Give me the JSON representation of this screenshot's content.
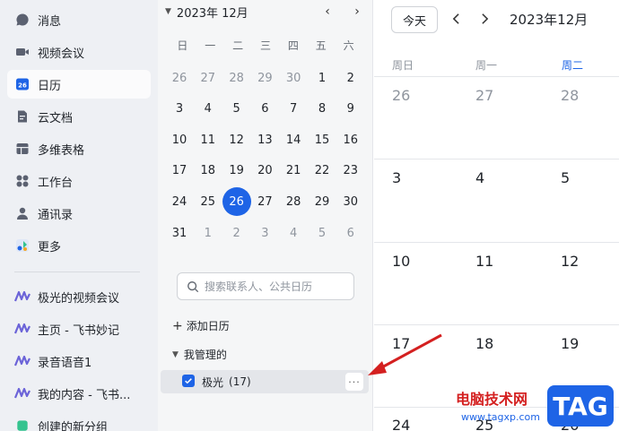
{
  "nav": {
    "items": [
      {
        "label": "消息",
        "icon": "message-icon"
      },
      {
        "label": "视频会议",
        "icon": "video-icon"
      },
      {
        "label": "日历",
        "icon": "calendar-icon",
        "badge": "26"
      },
      {
        "label": "云文档",
        "icon": "doc-icon"
      },
      {
        "label": "多维表格",
        "icon": "table-icon"
      },
      {
        "label": "工作台",
        "icon": "grid-icon"
      },
      {
        "label": "通讯录",
        "icon": "contacts-icon"
      },
      {
        "label": "更多",
        "icon": "more-apps-icon"
      }
    ],
    "recent": [
      {
        "label": "极光的视频会议"
      },
      {
        "label": "主页 - 飞书妙记"
      },
      {
        "label": "录音语音1"
      },
      {
        "label": "我的内容 - 飞书..."
      },
      {
        "label": "创建的新分组"
      }
    ]
  },
  "mini_calendar": {
    "month_label": "2023年 12月",
    "prev": "‹",
    "next": "›",
    "weekdays": [
      "日",
      "一",
      "二",
      "三",
      "四",
      "五",
      "六"
    ],
    "weeks": [
      [
        "26",
        "27",
        "28",
        "29",
        "30",
        "1",
        "2"
      ],
      [
        "3",
        "4",
        "5",
        "6",
        "7",
        "8",
        "9"
      ],
      [
        "10",
        "11",
        "12",
        "13",
        "14",
        "15",
        "16"
      ],
      [
        "17",
        "18",
        "19",
        "20",
        "21",
        "22",
        "23"
      ],
      [
        "24",
        "25",
        "26",
        "27",
        "28",
        "29",
        "30"
      ],
      [
        "31",
        "1",
        "2",
        "3",
        "4",
        "5",
        "6"
      ]
    ],
    "today": "26"
  },
  "search": {
    "placeholder": "搜索联系人、公共日历"
  },
  "add_calendar": "添加日历",
  "managed_section": "我管理的",
  "calendar_entry": {
    "label": "极光",
    "count": "(17)",
    "more": "···"
  },
  "main": {
    "today_button": "今天",
    "title": "2023年12月",
    "columns": [
      "周日",
      "周一",
      "周二"
    ],
    "rows": [
      [
        "26",
        "27",
        "28"
      ],
      [
        "3",
        "4",
        "5"
      ],
      [
        "10",
        "11",
        "12"
      ],
      [
        "17",
        "18",
        "19"
      ],
      [
        "24",
        "25",
        "26"
      ]
    ]
  },
  "watermark": {
    "site_name": "电脑技术网",
    "url": "www.tagxp.com",
    "tag": "TAG"
  },
  "colors": {
    "accent": "#1e64e6",
    "arrow": "#d42020"
  }
}
